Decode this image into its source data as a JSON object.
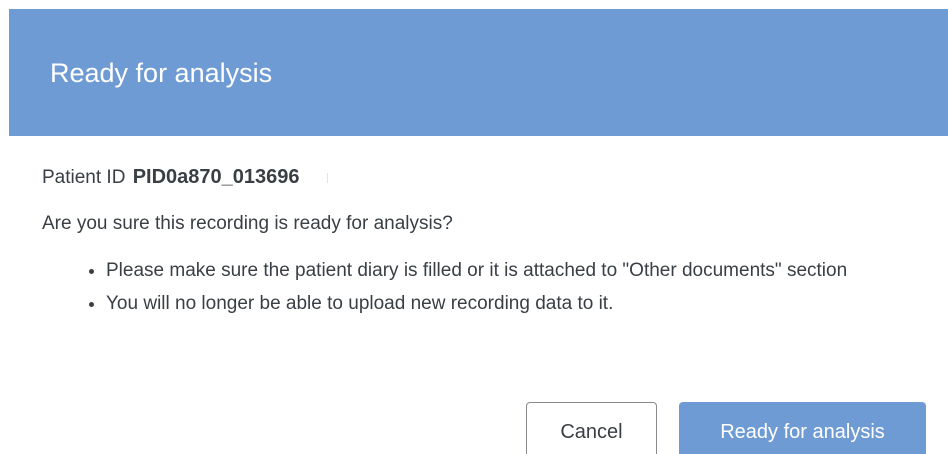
{
  "dialog": {
    "title": "Ready for analysis",
    "patient_id_label": "Patient ID",
    "patient_id_value": "PID0a870_013696",
    "question": "Are you sure this recording is ready for analysis?",
    "notes": [
      "Please make sure the patient diary is filled or it is attached to \"Other documents\" section",
      "You will no longer be able to upload new recording data to it."
    ],
    "buttons": {
      "cancel_label": "Cancel",
      "confirm_label": "Ready for analysis"
    }
  },
  "colors": {
    "header_background": "#6f9bd4",
    "confirm_button": "#6f9bd4",
    "text": "#3a3f45"
  }
}
